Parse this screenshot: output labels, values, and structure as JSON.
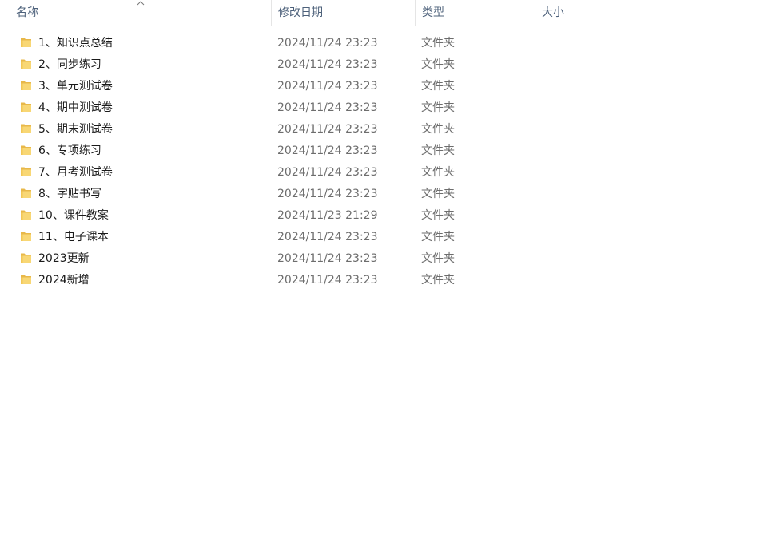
{
  "header": {
    "name": "名称",
    "date": "修改日期",
    "type": "类型",
    "size": "大小"
  },
  "colors": {
    "folder_front": "#f8d775",
    "folder_back": "#e8b84a",
    "header_text": "#4c607a"
  },
  "items": [
    {
      "name": "1、知识点总结",
      "date": "2024/11/24 23:23",
      "type": "文件夹",
      "size": ""
    },
    {
      "name": "2、同步练习",
      "date": "2024/11/24 23:23",
      "type": "文件夹",
      "size": ""
    },
    {
      "name": "3、单元测试卷",
      "date": "2024/11/24 23:23",
      "type": "文件夹",
      "size": ""
    },
    {
      "name": "4、期中测试卷",
      "date": "2024/11/24 23:23",
      "type": "文件夹",
      "size": ""
    },
    {
      "name": "5、期末测试卷",
      "date": "2024/11/24 23:23",
      "type": "文件夹",
      "size": ""
    },
    {
      "name": "6、专项练习",
      "date": "2024/11/24 23:23",
      "type": "文件夹",
      "size": ""
    },
    {
      "name": "7、月考测试卷",
      "date": "2024/11/24 23:23",
      "type": "文件夹",
      "size": ""
    },
    {
      "name": "8、字贴书写",
      "date": "2024/11/24 23:23",
      "type": "文件夹",
      "size": ""
    },
    {
      "name": "10、课件教案",
      "date": "2024/11/23 21:29",
      "type": "文件夹",
      "size": ""
    },
    {
      "name": "11、电子课本",
      "date": "2024/11/24 23:23",
      "type": "文件夹",
      "size": ""
    },
    {
      "name": "2023更新",
      "date": "2024/11/24 23:23",
      "type": "文件夹",
      "size": ""
    },
    {
      "name": "2024新增",
      "date": "2024/11/24 23:23",
      "type": "文件夹",
      "size": ""
    }
  ]
}
